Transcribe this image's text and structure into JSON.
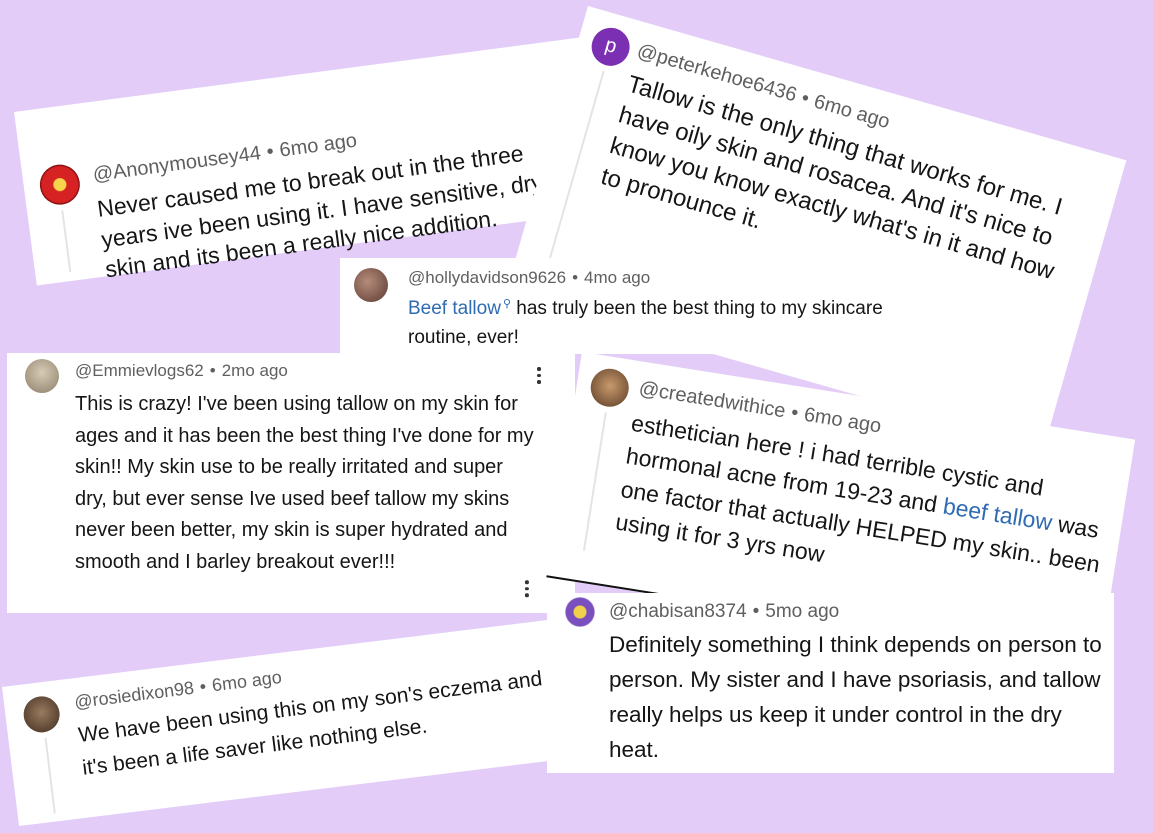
{
  "comments": [
    {
      "id": "anonymousey",
      "handle": "@Anonymousey44",
      "time": "6mo ago",
      "text": "Never caused me to break out in the three years ive been using it. I have sensitive, dry skin and its been a really nice addition."
    },
    {
      "id": "peterkehoe",
      "avatar_letter": "p",
      "handle": "@peterkehoe6436",
      "time": "6mo ago",
      "text": "Tallow is the only thing that works for me. I have oily skin and rosacea. And it's nice to know you know exactly what's in it and how to pronounce it."
    },
    {
      "id": "hollydavidson",
      "handle": "@hollydavidson9626",
      "time": "4mo ago",
      "link_text": "Beef tallow",
      "link_suffix": "⚲",
      "text": "has truly been the best thing to my skincare routine, ever!"
    },
    {
      "id": "emmievlogs",
      "handle": "@Emmievlogs62",
      "time": "2mo ago",
      "text": "This is crazy! I've been using tallow on my skin for ages and it has been the best thing I've done for my skin!! My skin use to be really irritated and super dry, but ever sense Ive used beef tallow my skins never been better, my skin is super hydrated and smooth and I barley breakout ever!!!"
    },
    {
      "id": "createdwithice",
      "handle": "@createdwithice",
      "time": "6mo ago",
      "text_before": "esthetician here ! i had terrible cystic and hormonal acne from 19-23 and ",
      "link_text": "beef tallow",
      "text_after": " was one factor that actually HELPED my skin.. been using it for 3 yrs now"
    },
    {
      "id": "rosiedixon",
      "handle": "@rosiedixon98",
      "time": "6mo ago",
      "text": "We have been using this on my son's eczema and it's been a life saver like nothing else."
    },
    {
      "id": "chabisan",
      "handle": "@chabisan8374",
      "time": "5mo ago",
      "text": "Definitely something I think depends on person to person. My sister and I have psoriasis, and tallow really helps us keep it under control in the dry heat."
    }
  ],
  "colors": {
    "background": "#e3cdf8",
    "link": "#2f6bb2",
    "peter_avatar": "#7b2fb2",
    "meta": "#5f5f5f"
  },
  "icons": [
    "flower-avatar-icon",
    "search-icon",
    "more-options-icon",
    "avatar-photo"
  ]
}
